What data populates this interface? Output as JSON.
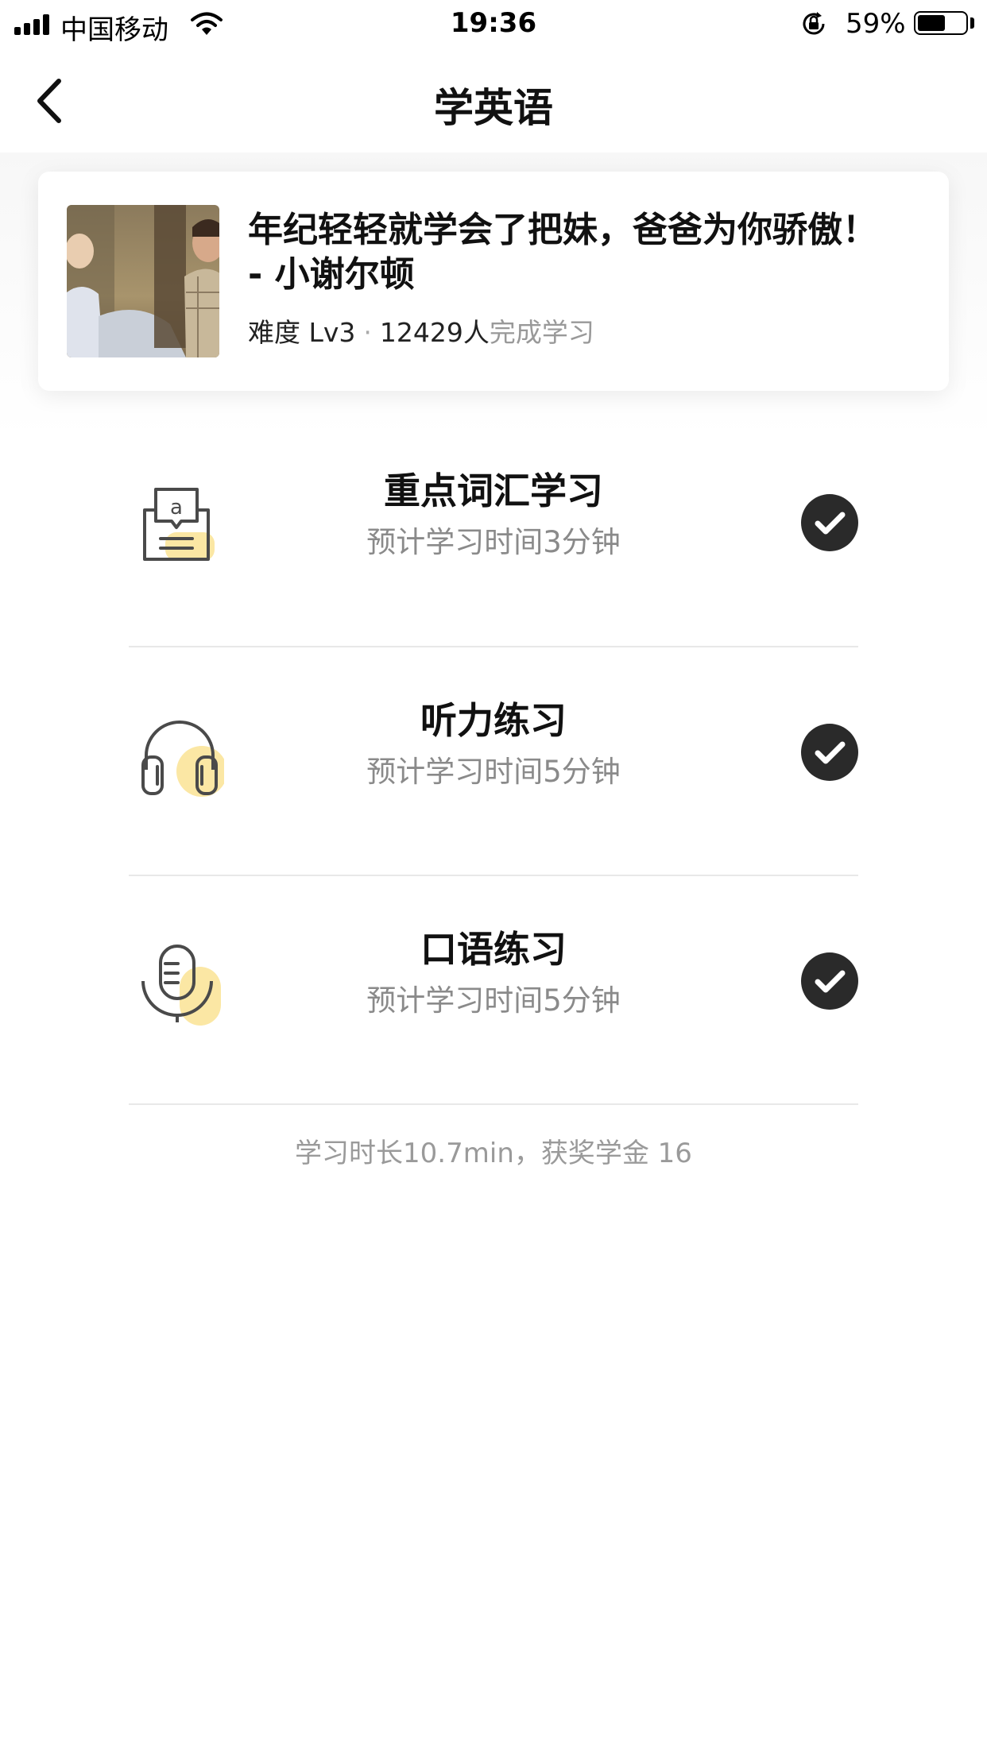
{
  "status_bar": {
    "carrier": "中国移动",
    "time": "19:36",
    "battery_percent": "59%",
    "battery_level": 0.59
  },
  "nav": {
    "title": "学英语",
    "back_icon": "chevron-left-icon"
  },
  "course": {
    "title": "年纪轻轻就学会了把妹，爸爸为你骄傲！ - 小谢尔顿",
    "difficulty": "难度 Lv3",
    "learners": "12429人",
    "learners_suffix": "完成学习",
    "separator": "·"
  },
  "tasks": [
    {
      "icon": "vocabulary-icon",
      "title": "重点词汇学习",
      "subtitle": "预计学习时间3分钟",
      "done": true
    },
    {
      "icon": "headphones-icon",
      "title": "听力练习",
      "subtitle": "预计学习时间5分钟",
      "done": true
    },
    {
      "icon": "microphone-icon",
      "title": "口语练习",
      "subtitle": "预计学习时间5分钟",
      "done": true
    }
  ],
  "summary": "学习时长10.7min，获奖学金 16",
  "colors": {
    "accent_yellow": "#FBE7A4",
    "check_bg": "#2A2A2A",
    "icon_stroke": "#4A4A4A",
    "secondary_text": "#8A8A8A"
  }
}
